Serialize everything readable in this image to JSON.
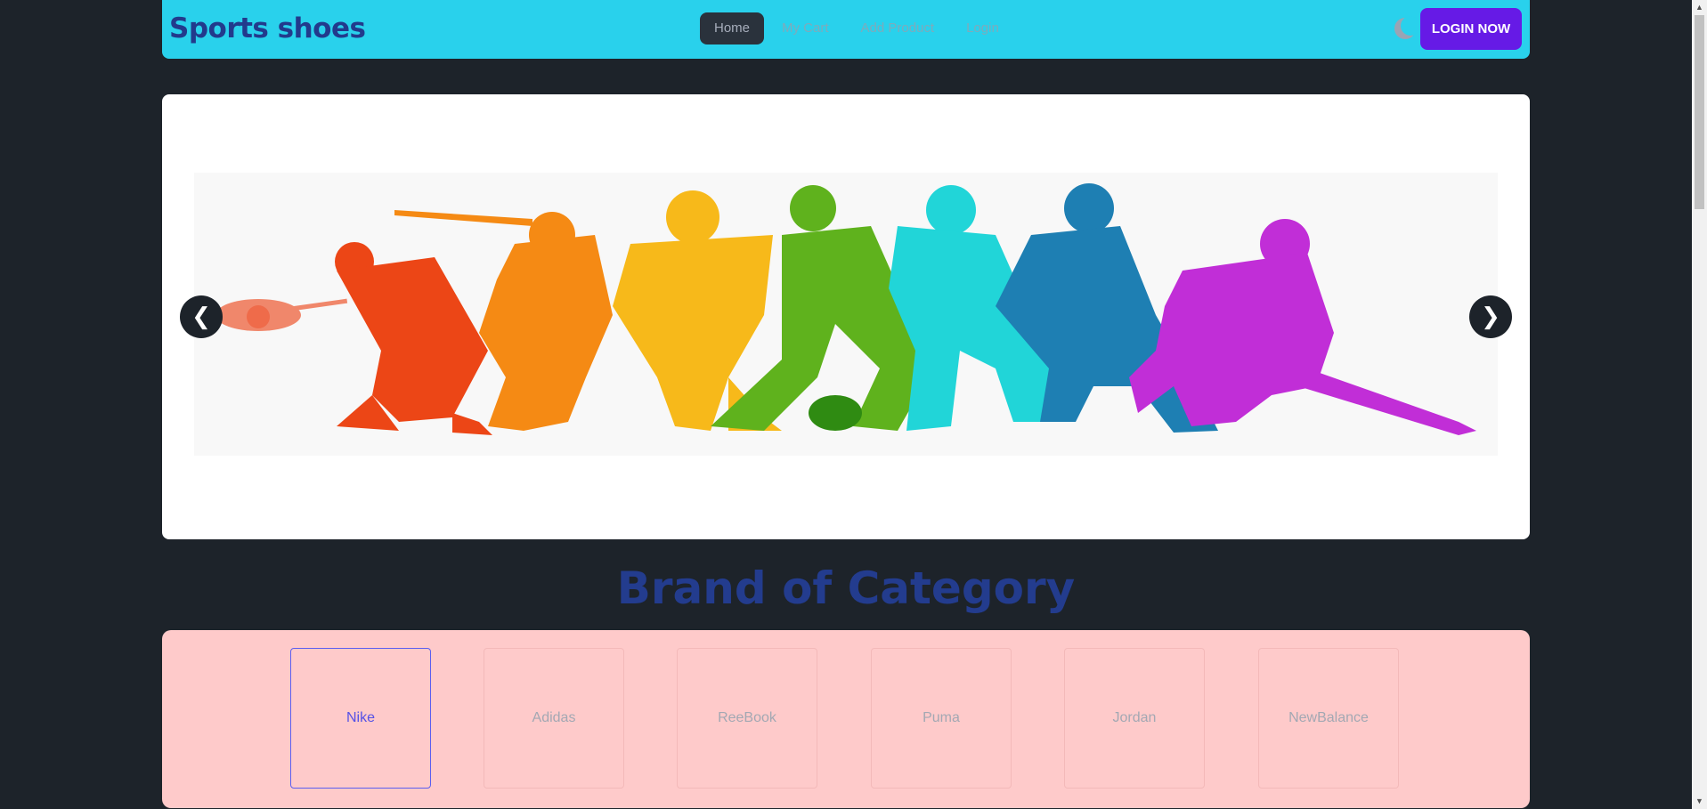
{
  "header": {
    "brand": "Sports shoes",
    "nav": [
      {
        "label": "Home",
        "active": true
      },
      {
        "label": "My Cart",
        "active": false
      },
      {
        "label": "Add Product",
        "active": false
      },
      {
        "label": "Login",
        "active": false
      }
    ],
    "theme_icon": "moon-icon",
    "login_button": "LOGIN NOW"
  },
  "carousel": {
    "prev_label": "❮",
    "next_label": "❯",
    "image": "sports-silhouettes-banner"
  },
  "categories": {
    "title": "Brand of Category",
    "tabs": [
      {
        "label": "Nike",
        "active": true
      },
      {
        "label": "Adidas",
        "active": false
      },
      {
        "label": "ReeBook",
        "active": false
      },
      {
        "label": "Puma",
        "active": false
      },
      {
        "label": "Jordan",
        "active": false
      },
      {
        "label": "NewBalance",
        "active": false
      }
    ]
  },
  "colors": {
    "background": "#1d232a",
    "navbar": "#29d1ec",
    "brand_text": "#223a8c",
    "login_button": "#661ae6",
    "category_panel": "#fecaca",
    "active_tab": "#5651e6"
  }
}
